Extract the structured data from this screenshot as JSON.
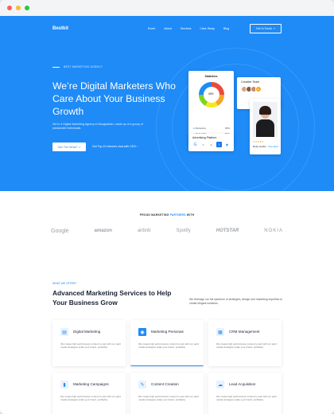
{
  "window": {
    "dots": [
      "#ff5f57",
      "#febc2e",
      "#28c840"
    ]
  },
  "nav": {
    "logo": "Bestkit",
    "items": [
      "Event",
      "About",
      "Services",
      "Case Study",
      "Blog"
    ],
    "cta": "Get In Touch ↗"
  },
  "hero": {
    "eyebrow": "BEST MARKETING AGENCY",
    "title": "We’re Digital Marketers Who Care About Your Business Growth",
    "description": "We're a Digital Marketing Agency in Bangladesh, made up of a group of passionate individuals.",
    "primary_btn": "See The What? ↗",
    "secondary_btn": "Get Top 10 minutes chat with CEO ›"
  },
  "stats_card": {
    "title": "Statistics",
    "center_value": "68%",
    "rows": [
      {
        "label": "Marketing",
        "value": "68%",
        "color": "#1e8bf7"
      },
      {
        "label": "SEO Skills",
        "value": "56%",
        "color": "#f5a623"
      },
      {
        "label": "Social",
        "value": "18%",
        "color": "#7ed321"
      }
    ],
    "donut_colors": [
      "#e94b3c",
      "#f5a623",
      "#f8e71c",
      "#7ed321",
      "#1e8bf7"
    ]
  },
  "creative_card": {
    "title": "Creative Team",
    "more": "2+"
  },
  "platform_card": {
    "title": "Advertising Platform"
  },
  "profile_card": {
    "stars": "★★★★★",
    "name": "Ruby Jenifer",
    "link": "View More"
  },
  "partners": {
    "title_prefix": "PROUD MARKETING ",
    "title_highlight": "PARTNERS",
    "title_suffix": " WITH",
    "logos": [
      "Google",
      "amazon",
      "airbnb",
      "Spotify",
      "HOTSTAR",
      "NOKIA"
    ]
  },
  "services": {
    "eyebrow": "WHAT WE OFFER?",
    "title": "Advanced Marketing Services to Help Your Business Grow",
    "description": "We leverage our full spectrum of strategies, design and marketing expertise to create elegant solutions.",
    "items": [
      {
        "title": "Digital Marketing",
        "icon": "chart-icon",
        "text": "We create high performance content to pair with our paid media strategies scale your brand, profitably."
      },
      {
        "title": "Marketing Personas",
        "icon": "persona-icon",
        "text": "We create high performance content to pair with our paid media strategies scale your brand, profitably."
      },
      {
        "title": "CRM Management",
        "icon": "crm-icon",
        "text": "We create high performance content to pair with our paid media strategies scale your brand, profitably."
      },
      {
        "title": "Marketing Campaigns",
        "icon": "campaign-icon",
        "text": "We create high performance content to pair with our paid media strategies scale your brand, profitably."
      },
      {
        "title": "Content Creation",
        "icon": "content-icon",
        "text": "We create high performance content to pair with our paid media strategies scale your brand, profitably."
      },
      {
        "title": "Lead Acquisition",
        "icon": "lead-icon",
        "text": "We create high performance content to pair with our paid media strategies scale your brand, profitably."
      }
    ]
  },
  "colors": {
    "brand": "#1e8bf7",
    "dark": "#1a2233"
  }
}
